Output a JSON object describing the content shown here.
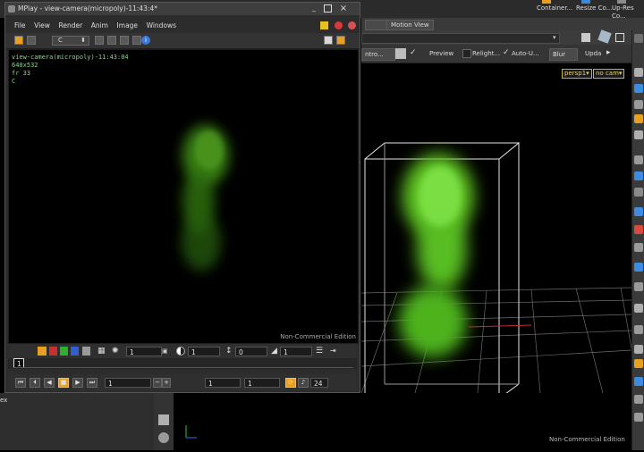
{
  "background": {
    "top_tabs": [
      "Container...",
      "Resize Co...",
      "Up-Res Co..."
    ],
    "pane_tab": "Motion View",
    "toolbar2": {
      "dropdown": "ntro...",
      "preview": "Preview",
      "relight": "Relight...",
      "auto_update": "Auto-U...",
      "blur": "Blur",
      "update": "Upda"
    },
    "camera_menu": "persp1▾",
    "cam_menu": "no cam▾",
    "watermark": "Non-Commercial Edition",
    "left_strip_text": "ex"
  },
  "mplay": {
    "title": "MPlay - view-camera(micropoly)-11:43:4*",
    "menu": [
      "File",
      "View",
      "Render",
      "Anim",
      "Image",
      "Windows"
    ],
    "channel": "C",
    "overlay": {
      "name": "view-camera(micropoly)-11:43:04",
      "resolution": "640x532",
      "frame": "fr 33",
      "channel": "C"
    },
    "watermark": "Non-Commercial Edition",
    "controls": {
      "gamma": "1",
      "exposure": "1",
      "offset": "0",
      "lut": "1",
      "layer": "1"
    },
    "playback": {
      "current_frame": "1",
      "start_frame": "1",
      "end_frame": "1",
      "fps": "24"
    }
  },
  "colors": {
    "smoke": "#6fd02a",
    "overlay_text": "#8fd08f",
    "accent": "#e8a020"
  }
}
